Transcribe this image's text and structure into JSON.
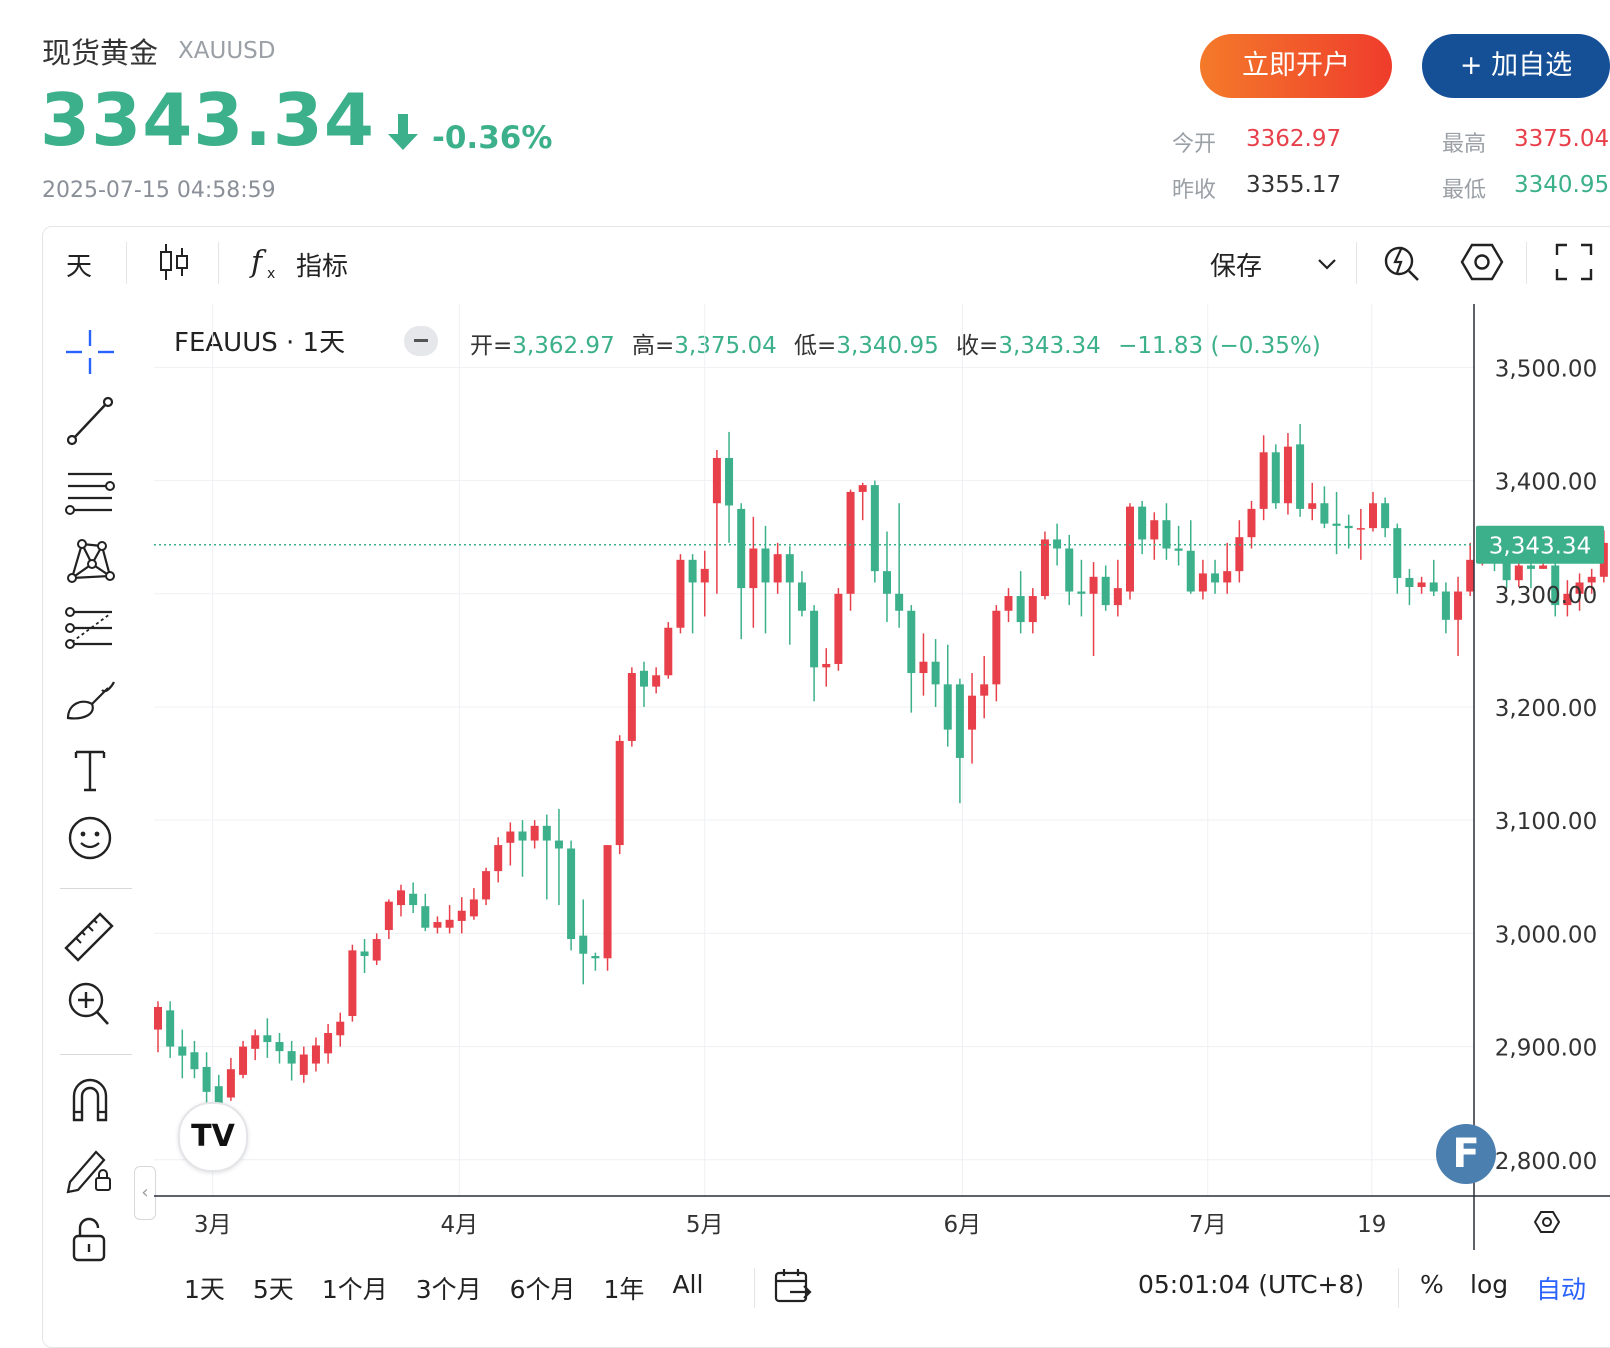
{
  "header": {
    "title": "现货黄金",
    "symbol": "XAUUSD",
    "price": "3343.34",
    "change_pct": "-0.36%",
    "timestamp": "2025-07-15 04:58:59",
    "colors": {
      "up": "#e8404a",
      "down": "#3bb08a",
      "open_btn": "#ef3c2c",
      "watch_btn": "#155096"
    }
  },
  "actions": {
    "open_account": "立即开户",
    "add_watch": "+ 加自选"
  },
  "stats": {
    "open_label": "今开",
    "open_value": "3362.97",
    "high_label": "最高",
    "high_value": "3375.04",
    "prev_close_label": "昨收",
    "prev_close_value": "3355.17",
    "low_label": "最低",
    "low_value": "3340.95"
  },
  "toolbar": {
    "interval": "天",
    "indicators": "指标",
    "save": "保存",
    "icons": [
      "candles-icon",
      "function-icon",
      "chevron-down-icon",
      "quick-search-icon",
      "settings-hexagon-icon",
      "fullscreen-icon"
    ]
  },
  "left_toolbar": {
    "icons": [
      "crosshair-icon",
      "trendline-icon",
      "parallel-channel-icon",
      "pattern-icon",
      "fib-icon",
      "brush-icon",
      "text-icon",
      "emoji-icon",
      "ruler-icon",
      "zoom-in-icon",
      "magnet-icon",
      "lock-draw-icon",
      "lock-icon"
    ]
  },
  "legend": {
    "name": "FEAUUS · 1天",
    "o_label": "开=",
    "o_value": "3,362.97",
    "h_label": "高=",
    "h_value": "3,375.04",
    "l_label": "低=",
    "l_value": "3,340.95",
    "c_label": "收=",
    "c_value": "3,343.34",
    "change": "−11.83 (−0.35%)"
  },
  "chart_data": {
    "type": "candlestick",
    "y_ticks": [
      "3,500.00",
      "3,400.00",
      "3,300.00",
      "3,200.00",
      "3,100.00",
      "3,000.00",
      "2,900.00",
      "2,800.00"
    ],
    "y_tick_values": [
      3500,
      3400,
      3300,
      3200,
      3100,
      3000,
      2900,
      2800
    ],
    "x_ticks": [
      "3月",
      "4月",
      "5月",
      "6月",
      "7月",
      "19"
    ],
    "last_price_label": "3,343.34",
    "last_price": 3343.34,
    "ylim": [
      2768,
      3556
    ],
    "grid": true,
    "candles": [
      [
        2915,
        2935,
        2895,
        2940
      ],
      [
        2932,
        2900,
        2890,
        2940
      ],
      [
        2900,
        2892,
        2872,
        2915
      ],
      [
        2895,
        2880,
        2872,
        2905
      ],
      [
        2882,
        2860,
        2843,
        2895
      ],
      [
        2865,
        2850,
        2843,
        2875
      ],
      [
        2855,
        2880,
        2852,
        2890
      ],
      [
        2875,
        2900,
        2872,
        2905
      ],
      [
        2898,
        2910,
        2888,
        2915
      ],
      [
        2910,
        2904,
        2890,
        2925
      ],
      [
        2904,
        2896,
        2885,
        2912
      ],
      [
        2896,
        2885,
        2870,
        2905
      ],
      [
        2875,
        2893,
        2868,
        2900
      ],
      [
        2885,
        2901,
        2878,
        2908
      ],
      [
        2894,
        2912,
        2885,
        2920
      ],
      [
        2910,
        2922,
        2900,
        2930
      ],
      [
        2927,
        2985,
        2922,
        2990
      ],
      [
        2984,
        2980,
        2965,
        2995
      ],
      [
        2976,
        2995,
        2972,
        3000
      ],
      [
        3003,
        3028,
        2995,
        3030
      ],
      [
        3025,
        3038,
        3015,
        3043
      ],
      [
        3035,
        3025,
        3018,
        3045
      ],
      [
        3024,
        3005,
        3002,
        3035
      ],
      [
        3005,
        3010,
        3000,
        3015
      ],
      [
        3005,
        3012,
        3000,
        3025
      ],
      [
        3011,
        3020,
        3000,
        3032
      ],
      [
        3015,
        3030,
        3012,
        3040
      ],
      [
        3030,
        3055,
        3025,
        3058
      ],
      [
        3055,
        3078,
        3045,
        3085
      ],
      [
        3080,
        3090,
        3060,
        3098
      ],
      [
        3090,
        3082,
        3050,
        3100
      ],
      [
        3082,
        3095,
        3075,
        3100
      ],
      [
        3095,
        3082,
        3030,
        3105
      ],
      [
        3082,
        3075,
        3025,
        3110
      ],
      [
        3075,
        2995,
        2985,
        3082
      ],
      [
        2998,
        2982,
        2955,
        3030
      ],
      [
        2980,
        2978,
        2967,
        2983
      ],
      [
        2978,
        3078,
        2967,
        3078
      ],
      [
        3078,
        3170,
        3070,
        3175
      ],
      [
        3170,
        3230,
        3165,
        3235
      ],
      [
        3232,
        3218,
        3200,
        3240
      ],
      [
        3218,
        3228,
        3212,
        3235
      ],
      [
        3228,
        3270,
        3225,
        3275
      ],
      [
        3270,
        3330,
        3265,
        3335
      ],
      [
        3330,
        3310,
        3265,
        3335
      ],
      [
        3310,
        3322,
        3280,
        3338
      ],
      [
        3380,
        3420,
        3300,
        3427
      ],
      [
        3420,
        3378,
        3345,
        3443
      ],
      [
        3375,
        3305,
        3260,
        3380
      ],
      [
        3305,
        3340,
        3270,
        3368
      ],
      [
        3340,
        3310,
        3265,
        3360
      ],
      [
        3310,
        3335,
        3300,
        3345
      ],
      [
        3335,
        3310,
        3255,
        3342
      ],
      [
        3310,
        3285,
        3280,
        3320
      ],
      [
        3285,
        3235,
        3205,
        3290
      ],
      [
        3235,
        3238,
        3218,
        3252
      ],
      [
        3238,
        3300,
        3232,
        3305
      ],
      [
        3300,
        3390,
        3285,
        3392
      ],
      [
        3390,
        3396,
        3365,
        3398
      ],
      [
        3396,
        3320,
        3310,
        3400
      ],
      [
        3320,
        3300,
        3275,
        3355
      ],
      [
        3300,
        3285,
        3270,
        3380
      ],
      [
        3285,
        3230,
        3195,
        3290
      ],
      [
        3230,
        3240,
        3210,
        3265
      ],
      [
        3240,
        3220,
        3200,
        3260
      ],
      [
        3220,
        3180,
        3165,
        3255
      ],
      [
        3220,
        3155,
        3115,
        3225
      ],
      [
        3180,
        3210,
        3150,
        3230
      ],
      [
        3210,
        3220,
        3190,
        3245
      ],
      [
        3220,
        3285,
        3205,
        3290
      ],
      [
        3285,
        3298,
        3275,
        3305
      ],
      [
        3298,
        3275,
        3265,
        3320
      ],
      [
        3275,
        3298,
        3265,
        3305
      ],
      [
        3298,
        3348,
        3295,
        3355
      ],
      [
        3348,
        3340,
        3325,
        3362
      ],
      [
        3340,
        3302,
        3290,
        3352
      ],
      [
        3302,
        3300,
        3280,
        3330
      ],
      [
        3300,
        3315,
        3245,
        3328
      ],
      [
        3315,
        3290,
        3285,
        3325
      ],
      [
        3290,
        3305,
        3280,
        3330
      ],
      [
        3302,
        3377,
        3295,
        3380
      ],
      [
        3377,
        3348,
        3335,
        3382
      ],
      [
        3348,
        3365,
        3330,
        3372
      ],
      [
        3365,
        3340,
        3330,
        3380
      ],
      [
        3340,
        3338,
        3325,
        3360
      ],
      [
        3338,
        3302,
        3300,
        3365
      ],
      [
        3302,
        3318,
        3295,
        3330
      ],
      [
        3318,
        3310,
        3300,
        3330
      ],
      [
        3310,
        3320,
        3300,
        3345
      ],
      [
        3320,
        3350,
        3310,
        3365
      ],
      [
        3350,
        3375,
        3340,
        3382
      ],
      [
        3375,
        3425,
        3365,
        3440
      ],
      [
        3425,
        3380,
        3375,
        3432
      ],
      [
        3380,
        3430,
        3370,
        3442
      ],
      [
        3432,
        3375,
        3368,
        3450
      ],
      [
        3375,
        3380,
        3365,
        3398
      ],
      [
        3380,
        3362,
        3358,
        3395
      ],
      [
        3362,
        3360,
        3335,
        3390
      ],
      [
        3360,
        3358,
        3340,
        3370
      ],
      [
        3358,
        3358,
        3330,
        3375
      ],
      [
        3358,
        3380,
        3355,
        3390
      ],
      [
        3380,
        3358,
        3350,
        3385
      ],
      [
        3358,
        3314,
        3300,
        3362
      ],
      [
        3314,
        3306,
        3290,
        3322
      ],
      [
        3306,
        3310,
        3300,
        3315
      ],
      [
        3310,
        3302,
        3298,
        3330
      ],
      [
        3302,
        3277,
        3265,
        3310
      ],
      [
        3277,
        3302,
        3245,
        3315
      ],
      [
        3302,
        3330,
        3298,
        3345
      ],
      [
        3330,
        3355,
        3325,
        3358
      ],
      [
        3355,
        3340,
        3320,
        3360
      ],
      [
        3340,
        3312,
        3305,
        3348
      ],
      [
        3312,
        3325,
        3306,
        3338
      ],
      [
        3325,
        3322,
        3305,
        3340
      ],
      [
        3322,
        3325,
        3322,
        3346
      ],
      [
        3325,
        3290,
        3280,
        3340
      ],
      [
        3290,
        3300,
        3280,
        3312
      ],
      [
        3300,
        3310,
        3285,
        3318
      ],
      [
        3310,
        3315,
        3300,
        3322
      ],
      [
        3315,
        3345,
        3310,
        3356
      ],
      [
        3355,
        3343.34,
        3340.95,
        3375.04
      ]
    ]
  },
  "time_bar": {
    "ranges": [
      "1天",
      "5天",
      "1个月",
      "3个月",
      "6个月",
      "1年",
      "All"
    ],
    "clock": "05:01:04 (UTC+8)",
    "percent": "%",
    "log": "log",
    "auto": "自动"
  },
  "logo": {
    "tv_text": "TV",
    "f_text": "F"
  }
}
